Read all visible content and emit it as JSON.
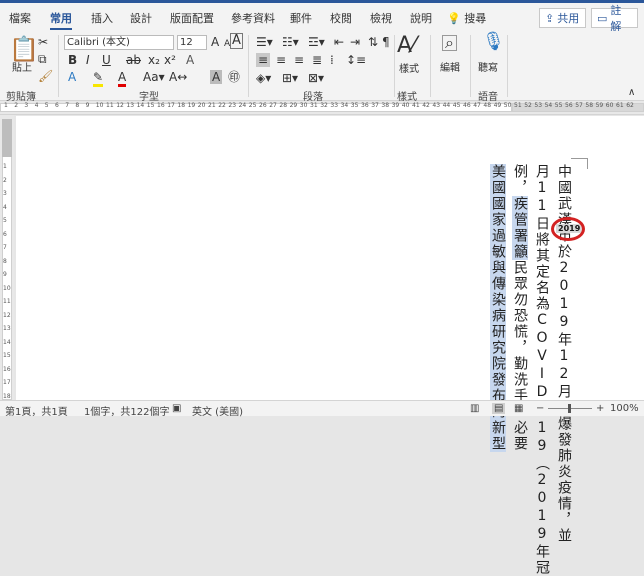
{
  "tabs": [
    {
      "label": "檔案",
      "active": false
    },
    {
      "label": "常用",
      "active": true
    },
    {
      "label": "插入",
      "active": false
    },
    {
      "label": "設計",
      "active": false
    },
    {
      "label": "版面配置",
      "active": false
    },
    {
      "label": "參考資料",
      "active": false
    },
    {
      "label": "郵件",
      "active": false
    },
    {
      "label": "校閱",
      "active": false
    },
    {
      "label": "檢視",
      "active": false
    },
    {
      "label": "說明",
      "active": false
    }
  ],
  "search_label": "搜尋",
  "share_label": "共用",
  "comment_label": "註解",
  "ribbon": {
    "clipboard": {
      "paste_label": "貼上",
      "group_label": "剪貼簿"
    },
    "font": {
      "name": "Calibri (本文)",
      "size": "12",
      "group_label": "字型"
    },
    "paragraph": {
      "group_label": "段落"
    },
    "styles": {
      "button_label": "樣式",
      "group_label": "樣式"
    },
    "editing": {
      "button_label": "編輯"
    },
    "voice": {
      "button_label": "聽寫",
      "group_label": "語音"
    }
  },
  "ruler_numbers": [
    "1",
    "2",
    "3",
    "4",
    "5",
    "6",
    "7",
    "8",
    "9",
    "10",
    "11",
    "12",
    "13",
    "14",
    "15",
    "16",
    "17",
    "18",
    "19",
    "20",
    "21",
    "22",
    "23",
    "24",
    "25",
    "26",
    "27",
    "28",
    "29",
    "30",
    "31",
    "32",
    "33",
    "34",
    "35",
    "36",
    "37",
    "38",
    "39",
    "40",
    "41",
    "42",
    "43",
    "44",
    "45",
    "46",
    "47",
    "48",
    "49",
    "50",
    "51",
    "52",
    "53",
    "54",
    "55",
    "56",
    "57",
    "58",
    "59",
    "60",
    "61",
    "62"
  ],
  "document": {
    "lines": [
      {
        "pre": "",
        "hl": "",
        "post": "中國武漢市於2019年12月起爆發肺炎疫情，並"
      },
      {
        "pre": "月11日將其定名為COVID-19（2019年冠",
        "hl": "",
        "post": ""
      },
      {
        "pre": "例，",
        "hl": "疾管署籲",
        "post": "民眾勿恐慌，勤洗手、必要"
      },
      {
        "pre": "",
        "hl": "美國國家過敏與傳染病研究院發布的新型",
        "post": ""
      }
    ],
    "annotation_text": "2019"
  },
  "status": {
    "page": "第1頁，共1頁",
    "words": "1個字，共122個字",
    "language": "英文 (美國)",
    "zoom": "100%"
  },
  "colors": {
    "accent": "#2b579a",
    "annotation": "#d32222",
    "highlight": "#c7d7ee"
  }
}
